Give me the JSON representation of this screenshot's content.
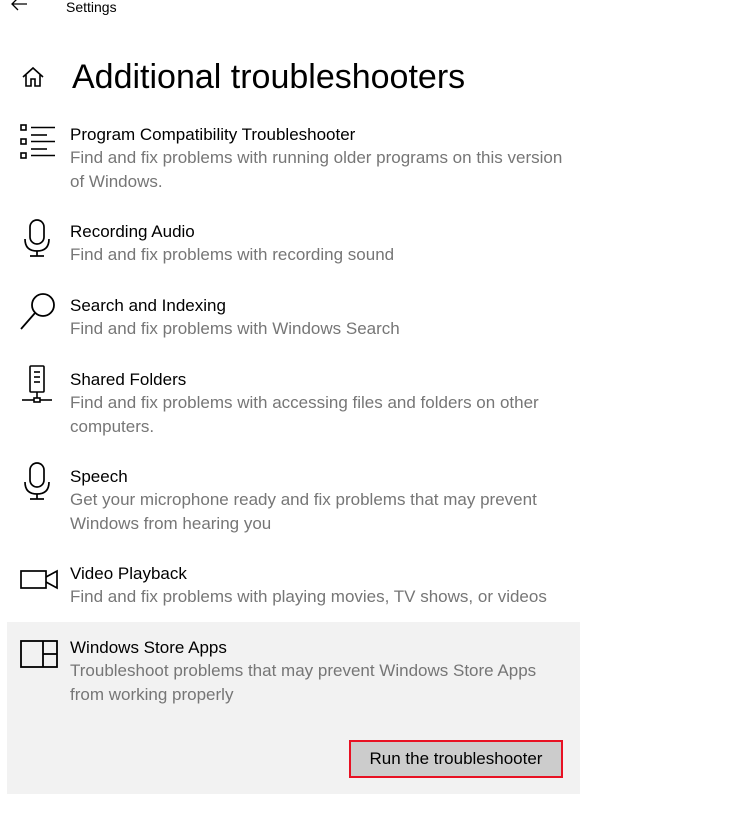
{
  "header": {
    "app_title": "Settings"
  },
  "page": {
    "title": "Additional troubleshooters"
  },
  "troubleshooters": [
    {
      "name": "Program Compatibility Troubleshooter",
      "description": "Find and fix problems with running older programs on this version of Windows.",
      "icon": "list-icon"
    },
    {
      "name": "Recording Audio",
      "description": "Find and fix problems with recording sound",
      "icon": "microphone-icon"
    },
    {
      "name": "Search and Indexing",
      "description": "Find and fix problems with Windows Search",
      "icon": "search-icon"
    },
    {
      "name": "Shared Folders",
      "description": "Find and fix problems with accessing files and folders on other computers.",
      "icon": "network-drive-icon"
    },
    {
      "name": "Speech",
      "description": "Get your microphone ready and fix problems that may prevent Windows from hearing you",
      "icon": "microphone-icon"
    },
    {
      "name": "Video Playback",
      "description": "Find and fix problems with playing movies, TV shows, or videos",
      "icon": "video-camera-icon"
    },
    {
      "name": "Windows Store Apps",
      "description": "Troubleshoot problems that may prevent Windows Store Apps from working properly",
      "icon": "store-apps-icon",
      "selected": true
    }
  ],
  "actions": {
    "run_button_label": "Run the troubleshooter"
  },
  "colors": {
    "selected_background": "#f2f2f2",
    "button_background": "#cccccc",
    "highlight_border": "#e81123",
    "description_text": "#767676"
  }
}
